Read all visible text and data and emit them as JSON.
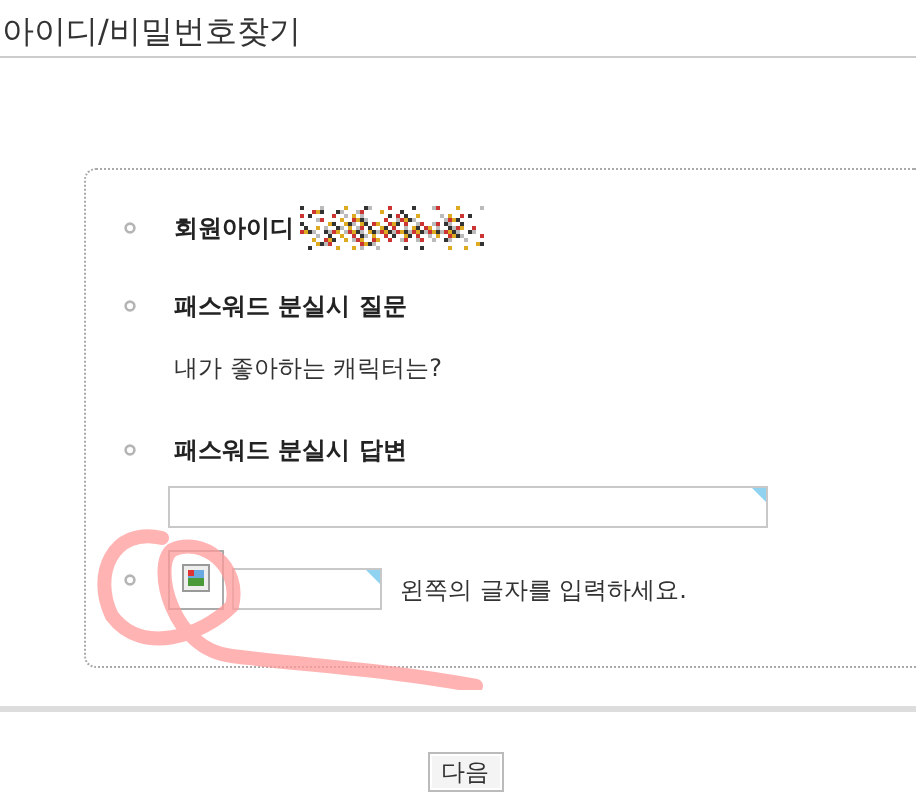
{
  "title": "아이디/비밀번호찾기",
  "fields": [
    {
      "kind": "id",
      "label": "회원아이디"
    },
    {
      "kind": "question",
      "label": "패스워드 분실시 질문",
      "value": "내가 좋아하는 캐릭터는?"
    },
    {
      "kind": "answer",
      "label": "패스워드 분실시 답변"
    },
    {
      "kind": "captcha",
      "hint": "왼쪽의 글자를 입력하세요."
    }
  ],
  "next_button": "다음"
}
